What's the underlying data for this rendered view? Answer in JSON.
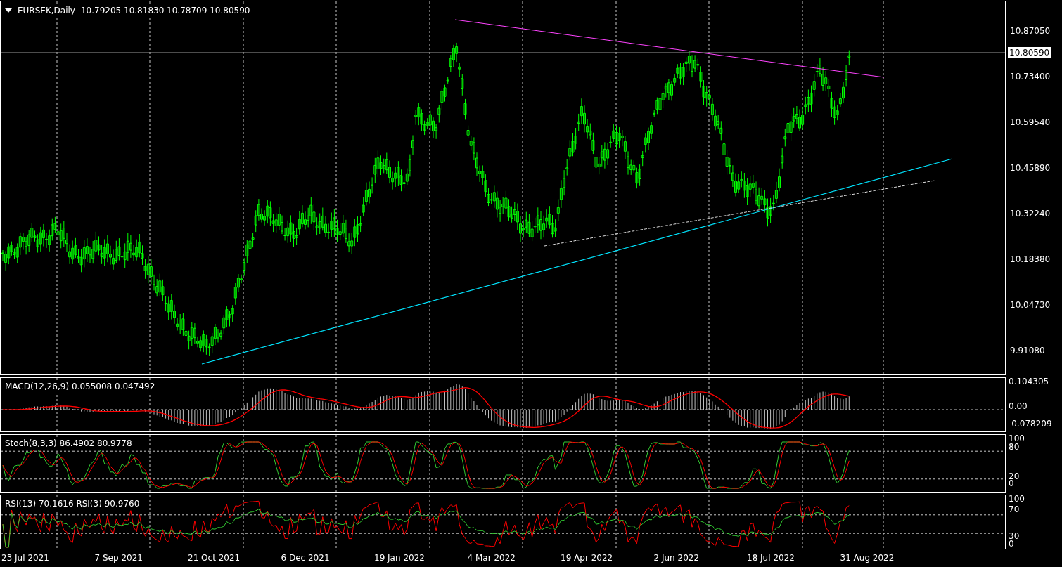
{
  "chart": {
    "symbol": "EURSEK,Daily",
    "quote": "10.79205 10.81830 10.78709 10.80590",
    "current_price": "10.80590",
    "price_axis": [
      "10.87050",
      "10.73400",
      "10.59540",
      "10.45890",
      "10.32240",
      "10.18380",
      "10.04730",
      "9.91080"
    ]
  },
  "indicators": [
    {
      "kind": "macd",
      "label": "MACD(12,26,9) 0.055008 0.047492",
      "axis_labels": [
        "0.104305",
        "0.00",
        "-0.078209"
      ]
    },
    {
      "kind": "stoch",
      "label": "Stoch(8,3,3) 86.4902 80.9778",
      "axis_labels": [
        "100",
        "80",
        "20",
        "0"
      ]
    },
    {
      "kind": "rsi",
      "label": "RSI(13) 70.1616  RSI(3) 90.9760",
      "axis_labels": [
        "100",
        "70",
        "30",
        "0"
      ]
    }
  ],
  "time_axis": [
    "23 Jul 2021",
    "7 Sep 2021",
    "21 Oct 2021",
    "6 Dec 2021",
    "19 Jan 2022",
    "4 Mar 2022",
    "19 Apr 2022",
    "2 Jun 2022",
    "18 Jul 2022",
    "31 Aug 2022"
  ]
}
